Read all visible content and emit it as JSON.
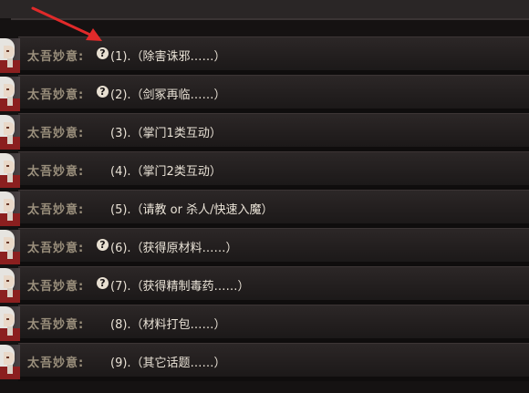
{
  "dialogue": {
    "speaker": "太吾妙意:",
    "options": [
      {
        "label": "(1).（除害诛邪……）",
        "has_hint_icon": true
      },
      {
        "label": "(2).（剑冢再临……）",
        "has_hint_icon": true
      },
      {
        "label": "(3).（掌门1类互动）",
        "has_hint_icon": false
      },
      {
        "label": "(4).（掌门2类互动）",
        "has_hint_icon": false
      },
      {
        "label": "(5).（请教 or 杀人/快速入魔）",
        "has_hint_icon": false
      },
      {
        "label": "(6).（获得原材料……）",
        "has_hint_icon": true
      },
      {
        "label": "(7).（获得精制毒药……）",
        "has_hint_icon": true
      },
      {
        "label": "(8).（材料打包……）",
        "has_hint_icon": false
      },
      {
        "label": "(9).（其它话题……）",
        "has_hint_icon": false
      }
    ]
  },
  "hint_icon": {
    "name": "question-hint-icon",
    "glyph": "?"
  },
  "annotation": {
    "name": "red-arrow-icon",
    "color": "#e02a2a"
  },
  "colors": {
    "speaker": "#9a8f7c",
    "option_text": "#e9e2d6",
    "row_background": "#241f1f",
    "page_background": "#151212"
  }
}
